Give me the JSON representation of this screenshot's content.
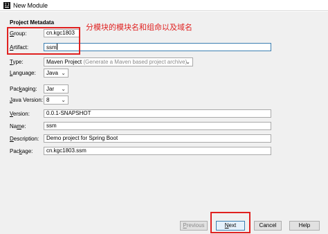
{
  "window": {
    "title": "New Module",
    "app_icon_text": "IJ"
  },
  "section_title": "Project Metadata",
  "annotation_text": "分模块的模块名和组命以及域名",
  "fields": {
    "group": {
      "label_key": "G",
      "label_rest": "roup:",
      "value": "cn.kgc1803"
    },
    "artifact": {
      "label_key": "A",
      "label_rest": "rtifact:",
      "value": "ssm"
    },
    "type": {
      "label_key": "T",
      "label_rest": "ype:",
      "value": "Maven Project",
      "hint": "(Generate a Maven based project archive)"
    },
    "language": {
      "label_key": "L",
      "label_rest": "anguage:",
      "value": "Java"
    },
    "packaging": {
      "label_pre": "Pac",
      "label_key": "k",
      "label_rest": "aging:",
      "value": "Jar"
    },
    "java_version": {
      "label_key": "J",
      "label_rest": "ava Version:",
      "value": "8"
    },
    "version": {
      "label_key": "V",
      "label_rest": "ersion:",
      "value": "0.0.1-SNAPSHOT"
    },
    "name": {
      "label_pre": "Na",
      "label_key": "m",
      "label_rest": "e:",
      "value": "ssm"
    },
    "description": {
      "label_key": "D",
      "label_rest": "escription:",
      "value": "Demo project for Spring Boot"
    },
    "package": {
      "label_pre": "Pac",
      "label_key": "k",
      "label_rest": "age:",
      "value": "cn.kgc1803.ssm"
    }
  },
  "buttons": {
    "previous": {
      "label_key": "P",
      "label_rest": "revious"
    },
    "next": {
      "label_key": "N",
      "label_rest": "ext"
    },
    "cancel": "Cancel",
    "help": "Help"
  },
  "colors": {
    "annotation": "#e0201f",
    "focus_border": "#3c7fb1",
    "dialog_bg": "#f0f0f0"
  }
}
